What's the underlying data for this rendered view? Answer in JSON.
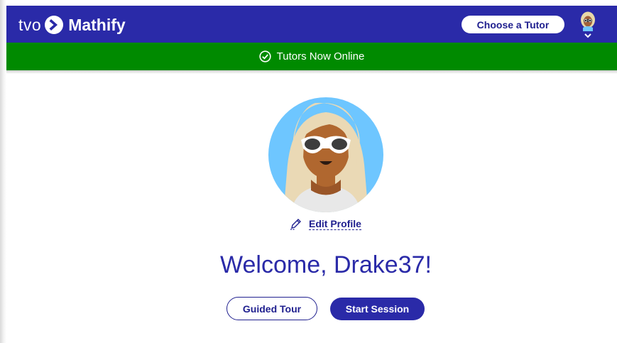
{
  "header": {
    "brand_prefix": "tvo",
    "brand_name": "Mathify",
    "brand_icon": "chevron-mark-icon",
    "choose_tutor_label": "Choose a Tutor",
    "user_menu_icon": "chevron-down-icon"
  },
  "status": {
    "icon": "check-circle-icon",
    "text": "Tutors Now Online"
  },
  "profile": {
    "edit_label": "Edit Profile",
    "edit_icon": "pencil-icon"
  },
  "main": {
    "welcome": "Welcome, Drake37!"
  },
  "actions": {
    "guided_tour_label": "Guided Tour",
    "start_session_label": "Start Session"
  },
  "colors": {
    "header_bg": "#2a2aa8",
    "status_bg": "#008a00",
    "accent": "#20208f",
    "avatar_bg": "#6ec6ff"
  }
}
